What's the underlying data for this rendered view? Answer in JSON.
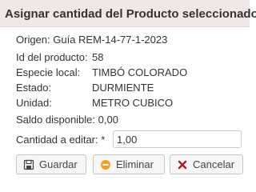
{
  "dialog": {
    "title": "Asignar cantidad del Producto seleccionado"
  },
  "details": {
    "origin": "Origen: Guía REM-14-77-1-2023",
    "product_id_label": "Id del producto:",
    "product_id_value": "58",
    "species_label": "Especie local:",
    "species_value": "TIMBÓ COLORADO",
    "state_label": "Estado:",
    "state_value": "DURMIENTE",
    "unit_label": "Unidad:",
    "unit_value": "METRO CUBICO",
    "balance": "Saldo disponible: 0,00"
  },
  "quantity": {
    "label": "Cantidad a editar:  *",
    "value": "1,00"
  },
  "buttons": {
    "save": "Guardar",
    "delete": "Eliminar",
    "cancel": "Cancelar"
  },
  "colors": {
    "titlebar": "#f0e7e6",
    "delete_icon": "#f0a02c",
    "cancel_icon": "#a41d2a"
  },
  "icons": {
    "save": "floppy-disk-icon",
    "delete": "minus-circle-icon",
    "cancel": "close-x-icon"
  }
}
